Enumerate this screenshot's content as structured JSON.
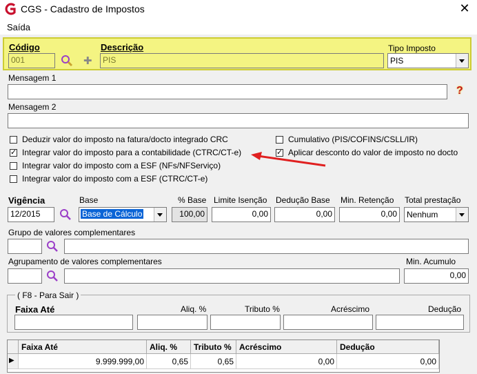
{
  "window": {
    "title": "CGS - Cadastro de Impostos",
    "close_glyph": "✕"
  },
  "menu": {
    "items": [
      "Saída"
    ]
  },
  "header": {
    "codigo_label": "Código",
    "codigo_value": "001",
    "descricao_label": "Descrição",
    "descricao_value": "PIS",
    "tipo_label": "Tipo Imposto",
    "tipo_value": "PIS"
  },
  "mensagem1": {
    "label": "Mensagem 1",
    "value": "",
    "help_glyph": "?"
  },
  "mensagem2": {
    "label": "Mensagem 2",
    "value": ""
  },
  "checkboxes": [
    {
      "label": "Deduzir valor do imposto na fatura/docto integrado CRC",
      "checked": false
    },
    {
      "label": "Integrar valor do imposto para a contabilidade (CTRC/CT-e)",
      "checked": true
    },
    {
      "label": "Integrar valor do imposto com a ESF (NFs/NFServiço)",
      "checked": false
    },
    {
      "label": "Integrar valor do imposto com a ESF (CTRC/CT-e)",
      "checked": false
    },
    {
      "label": "Cumulativo (PIS/COFINS/CSLL/IR)",
      "checked": false
    },
    {
      "label": "Aplicar desconto do valor de imposto no docto",
      "checked": true
    }
  ],
  "vigencia": {
    "label": "Vigência",
    "value": "12/2015",
    "base_label": "Base",
    "base_value": "Base de Cálculo",
    "pct_base_label": "% Base",
    "pct_base_value": "100,00",
    "limite_label": "Limite Isenção",
    "limite_value": "0,00",
    "deducao_label": "Dedução Base",
    "deducao_value": "0,00",
    "retencao_label": "Min. Retenção",
    "retencao_value": "0,00",
    "total_label": "Total prestação",
    "total_value": "Nenhum"
  },
  "grupo": {
    "label": "Grupo de valores complementares",
    "code": "",
    "desc": ""
  },
  "agrupamento": {
    "label": "Agrupamento de valores complementares",
    "code": "",
    "desc": "",
    "min_label": "Min. Acumulo",
    "min_value": "0,00"
  },
  "faixa": {
    "legend": "( F8 - Para Sair )",
    "cols": [
      "Faixa Até",
      "Aliq. %",
      "Tributo %",
      "Acréscimo",
      "Dedução"
    ]
  },
  "grid": {
    "headers": [
      "Faixa Até",
      "Aliq. %",
      "Tributo %",
      "Acréscimo",
      "Dedução"
    ],
    "rows": [
      [
        "9.999.999,00",
        "0,65",
        "0,65",
        "0,00",
        "0,00"
      ]
    ],
    "row_indicator": "▶"
  },
  "colors": {
    "header_bg": "#f4f482",
    "arrow": "#e02020",
    "logo": "#c8102e",
    "search": "#9b3fc8"
  }
}
